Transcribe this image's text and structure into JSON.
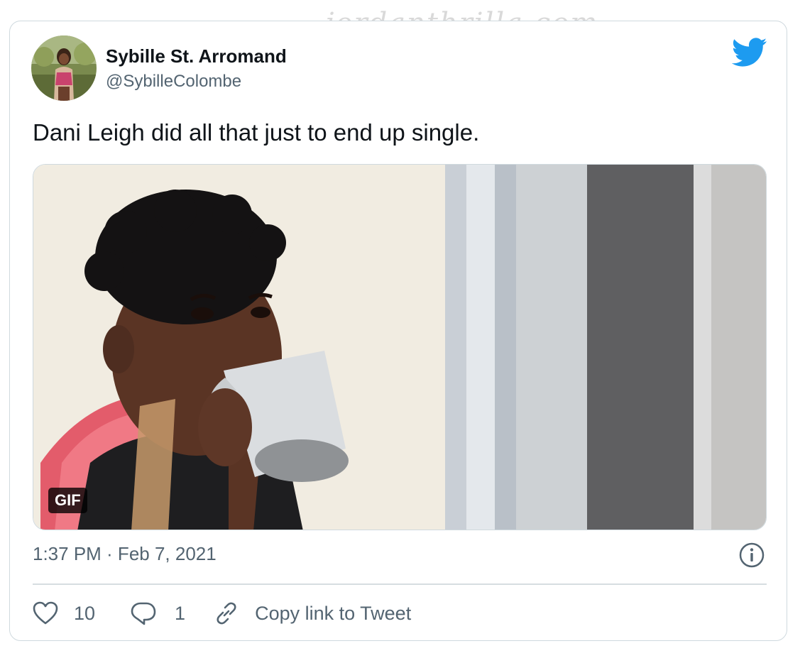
{
  "watermark": "jordanthrilla·com",
  "tweet": {
    "author_name": "Sybille St. Arromand",
    "author_handle": "@SybilleColombe",
    "text": "Dani Leigh did all that just to end up single.",
    "media_badge": "GIF",
    "timestamp": "1:37 PM · Feb 7, 2021"
  },
  "actions": {
    "likes": "10",
    "replies": "1",
    "copy_link_label": "Copy link to Tweet"
  },
  "icons": {
    "brand": "twitter-bird-icon",
    "info": "info-icon",
    "like": "heart-icon",
    "reply": "reply-bubble-icon",
    "link": "link-icon"
  },
  "colors": {
    "twitter_blue": "#1d9bf0",
    "text_primary": "#0f1419",
    "text_secondary": "#536471",
    "border": "#cfd9de"
  }
}
